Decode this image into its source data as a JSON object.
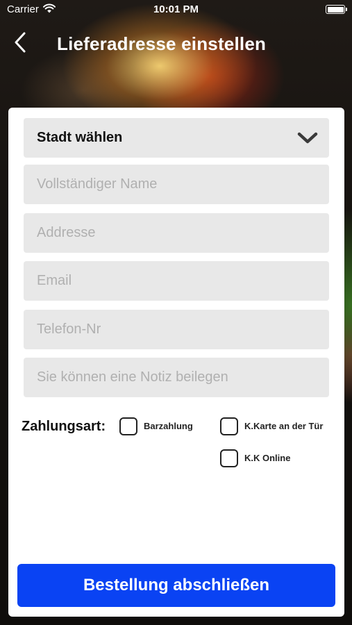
{
  "status_bar": {
    "carrier": "Carrier",
    "time": "10:01 PM"
  },
  "nav": {
    "title": "Lieferadresse einstellen",
    "back_icon": "chevron-left-icon"
  },
  "form": {
    "city_select": {
      "value": "Stadt wählen",
      "icon": "chevron-down-icon"
    },
    "fields": {
      "full_name": {
        "placeholder": "Vollständiger Name",
        "value": ""
      },
      "address": {
        "placeholder": "Addresse",
        "value": ""
      },
      "email": {
        "placeholder": "Email",
        "value": ""
      },
      "phone": {
        "placeholder": "Telefon-Nr",
        "value": ""
      },
      "note": {
        "placeholder": "Sie können eine Notiz beilegen",
        "value": ""
      }
    },
    "payment": {
      "label": "Zahlungsart:",
      "options": [
        {
          "label": "Barzahlung",
          "checked": false
        },
        {
          "label": "K.Karte an der Tür",
          "checked": false
        },
        {
          "label": "K.K Online",
          "checked": false
        }
      ]
    },
    "submit_label": "Bestellung abschließen"
  },
  "colors": {
    "primary_button": "#0a43f3",
    "field_background": "#e8e8e8",
    "placeholder": "#b0b0b0"
  }
}
